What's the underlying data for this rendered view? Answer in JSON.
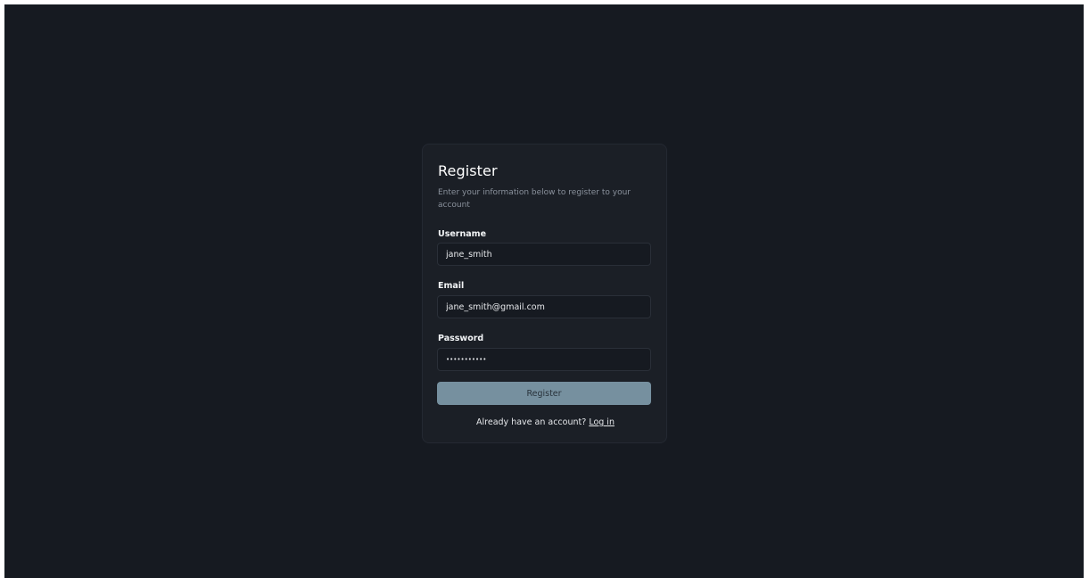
{
  "register": {
    "title": "Register",
    "subtitle": "Enter your information below to register to your account",
    "username_label": "Username",
    "username_value": "jane_smith",
    "email_label": "Email",
    "email_value": "jane_smith@gmail.com",
    "password_label": "Password",
    "password_value": "•••••••••••",
    "submit_label": "Register",
    "footer_text": "Already have an account?",
    "login_link": "Log in"
  },
  "colors": {
    "background": "#161a21",
    "card": "#1b1f26",
    "button": "#76909f"
  }
}
